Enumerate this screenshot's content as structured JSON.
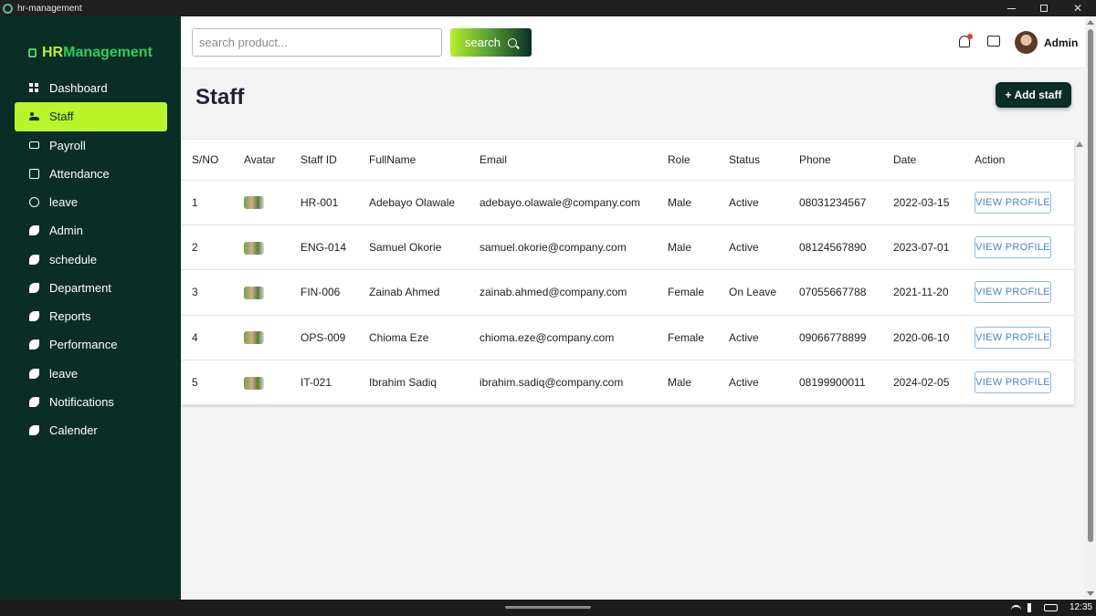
{
  "window": {
    "title": "hr-management"
  },
  "sidebar": {
    "brand_part1": "HR",
    "brand_part2": "Management",
    "items": [
      {
        "label": "Dashboard",
        "icon": "dashboard-icon"
      },
      {
        "label": "Staff",
        "icon": "people-icon",
        "active": true
      },
      {
        "label": "Payroll",
        "icon": "payroll-icon"
      },
      {
        "label": "Attendance",
        "icon": "calendar-icon"
      },
      {
        "label": "leave",
        "icon": "clock-off-icon"
      },
      {
        "label": "Admin",
        "icon": "leaf-icon"
      },
      {
        "label": "schedule",
        "icon": "leaf-icon"
      },
      {
        "label": "Department",
        "icon": "leaf-icon"
      },
      {
        "label": "Reports",
        "icon": "leaf-icon"
      },
      {
        "label": "Performance",
        "icon": "leaf-icon"
      },
      {
        "label": "leave",
        "icon": "leaf-icon"
      },
      {
        "label": "Notifications",
        "icon": "leaf-icon"
      },
      {
        "label": "Calender",
        "icon": "leaf-icon"
      }
    ]
  },
  "header": {
    "search_placeholder": "search product...",
    "search_label": "search",
    "user_name": "Admin"
  },
  "page": {
    "title": "Staff",
    "add_label": "+ Add staff"
  },
  "table": {
    "columns": [
      "S/NO",
      "Avatar",
      "Staff ID",
      "FullName",
      "Email",
      "Role",
      "Status",
      "Phone",
      "Date",
      "Action"
    ],
    "action_label": "VIEW PROFILE",
    "rows": [
      {
        "sno": "1",
        "id": "HR-001",
        "name": "Adebayo Olawale",
        "email": "adebayo.olawale@company.com",
        "role": "Male",
        "status": "Active",
        "phone": "08031234567",
        "date": "2022-03-15"
      },
      {
        "sno": "2",
        "id": "ENG-014",
        "name": "Samuel Okorie",
        "email": "samuel.okorie@company.com",
        "role": "Male",
        "status": "Active",
        "phone": "08124567890",
        "date": "2023-07-01"
      },
      {
        "sno": "3",
        "id": "FIN-006",
        "name": "Zainab Ahmed",
        "email": "zainab.ahmed@company.com",
        "role": "Female",
        "status": "On Leave",
        "phone": "07055667788",
        "date": "2021-11-20"
      },
      {
        "sno": "4",
        "id": "OPS-009",
        "name": "Chioma Eze",
        "email": "chioma.eze@company.com",
        "role": "Female",
        "status": "Active",
        "phone": "09066778899",
        "date": "2020-06-10"
      },
      {
        "sno": "5",
        "id": "IT-021",
        "name": "Ibrahim Sadiq",
        "email": "ibrahim.sadiq@company.com",
        "role": "Male",
        "status": "Active",
        "phone": "08199900011",
        "date": "2024-02-05"
      }
    ]
  },
  "taskbar": {
    "time": "12:35"
  },
  "colors": {
    "sidebar_bg": "#0a2e25",
    "accent": "#b8f52a",
    "brand_green": "#2ecc5e",
    "link_blue": "#4a86c8"
  }
}
